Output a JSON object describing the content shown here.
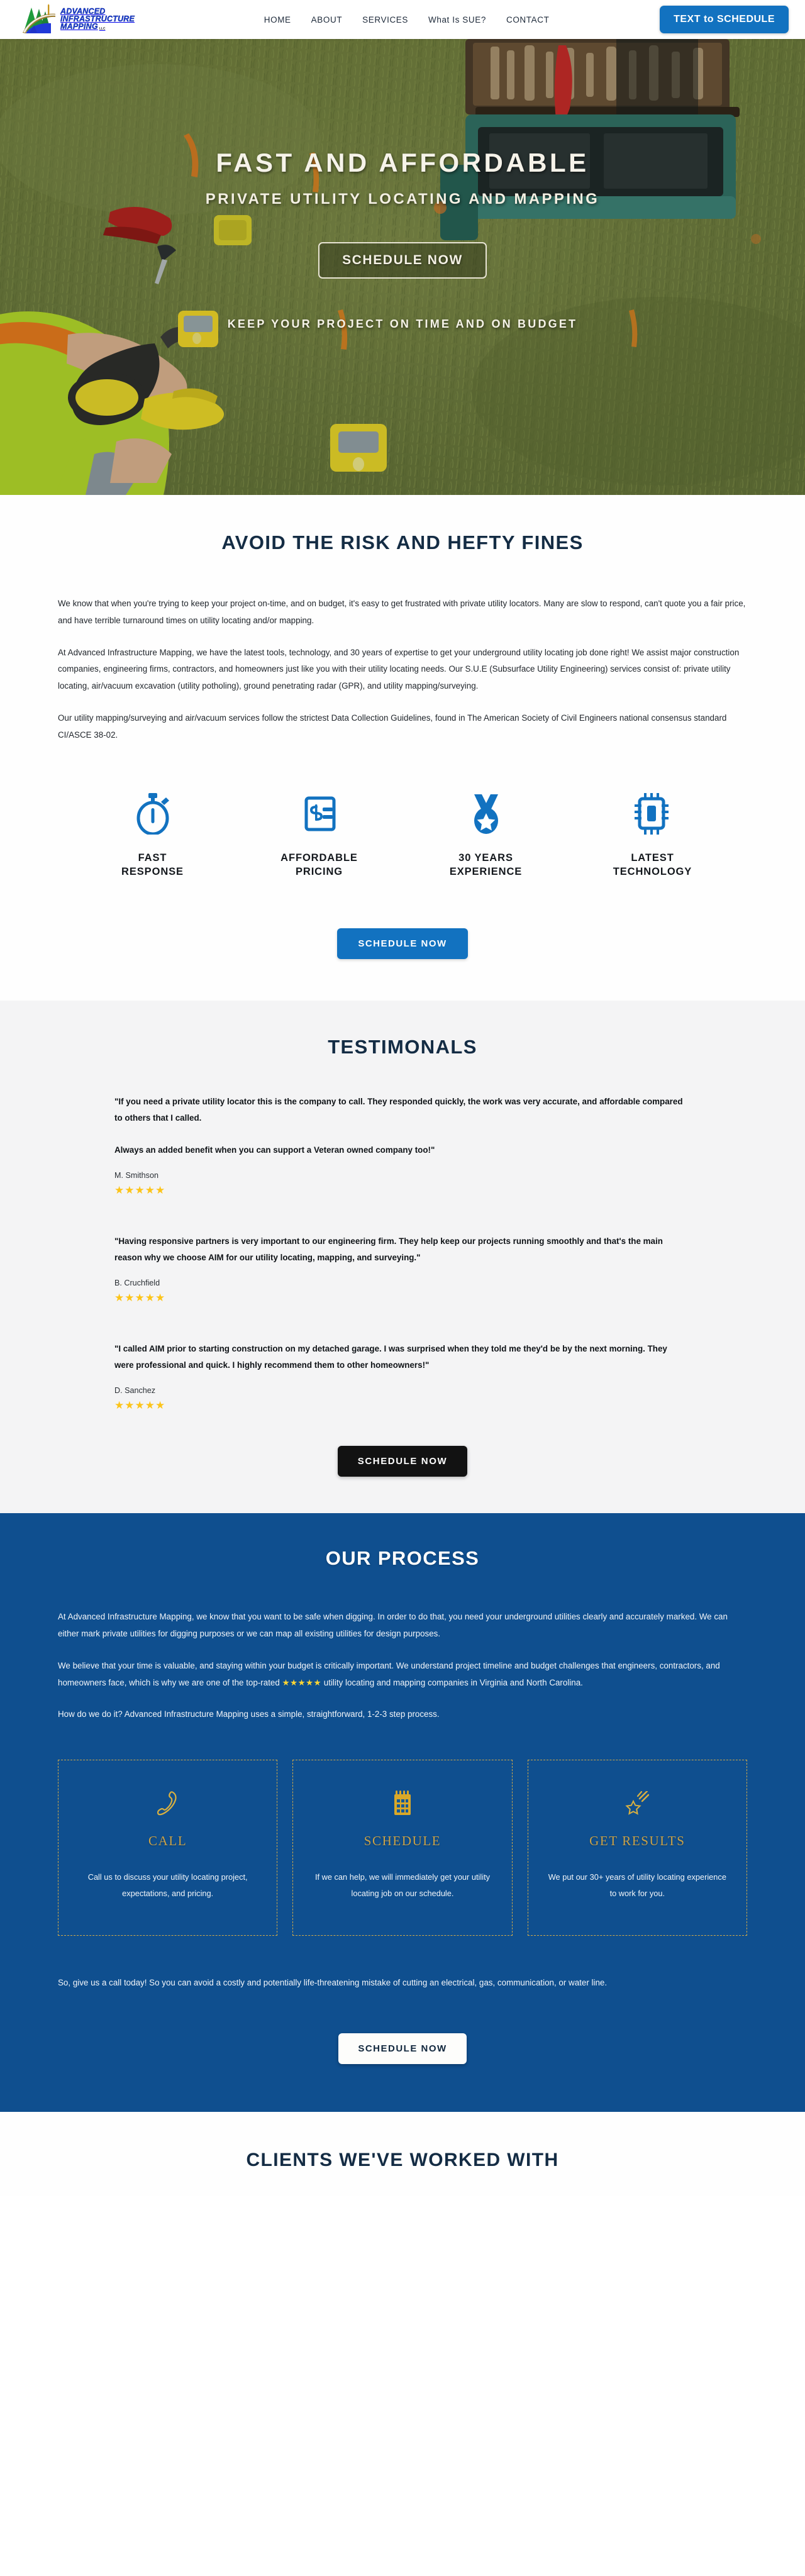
{
  "header": {
    "logo": {
      "line1": "ADVANCED",
      "line2": "INFRASTRUCTURE",
      "line3": "MAPPING",
      "suffix": "LLC"
    },
    "nav": [
      {
        "label": "HOME"
      },
      {
        "label": "ABOUT"
      },
      {
        "label": "SERVICES"
      },
      {
        "label": "What Is SUE?"
      },
      {
        "label": "CONTACT"
      }
    ],
    "cta_label": "TEXT to SCHEDULE"
  },
  "hero": {
    "headline": "FAST AND AFFORDABLE",
    "subheadline": "PRIVATE UTILITY LOCATING AND MAPPING",
    "cta_label": "SCHEDULE NOW",
    "tagline": "KEEP YOUR PROJECT ON TIME AND ON BUDGET"
  },
  "risk": {
    "title": "AVOID THE RISK AND HEFTY FINES",
    "paragraphs": [
      "We know that when you're trying to keep your project on-time, and on budget, it's easy to get frustrated with private utility locators. Many are slow to respond, can't quote you a fair price, and have terrible turnaround times on utility locating and/or mapping.",
      "At Advanced Infrastructure Mapping, we have the latest tools, technology, and 30 years of expertise to get your underground utility locating job done right! We assist major construction companies, engineering firms, contractors, and homeowners just like you with their utility locating needs.  Our S.U.E (Subsurface Utility Engineering)  services consist of: private utility locating, air/vacuum excavation (utility potholing), ground penetrating radar (GPR), and utility mapping/surveying.",
      "Our utility mapping/surveying and air/vacuum services follow the strictest Data Collection Guidelines, found in The American Society of Civil Engineers national consensus standard CI/ASCE 38-02."
    ],
    "features": [
      {
        "icon": "stopwatch-icon",
        "label": "FAST RESPONSE"
      },
      {
        "icon": "invoice-dollar-icon",
        "label": "AFFORDABLE PRICING"
      },
      {
        "icon": "medal-icon",
        "label": "30 YEARS EXPERIENCE"
      },
      {
        "icon": "microchip-icon",
        "label": "LATEST TECHNOLOGY"
      }
    ],
    "cta_label": "SCHEDULE NOW"
  },
  "testimonials": {
    "title": "TESTIMONALS",
    "items": [
      {
        "quote1": "\"If you need a private utility locator this is the company to call. They responded quickly, the work was very accurate, and affordable compared to others that I called.",
        "quote2": "Always an added benefit when you can support a Veteran owned company too!\"",
        "author": "M. Smithson",
        "stars": "★★★★★"
      },
      {
        "quote1": "\"Having responsive partners is very important to our engineering firm.  They help keep our projects running smoothly and that's the main reason why we choose AIM for our utility locating, mapping, and surveying.\"",
        "quote2": "",
        "author": "B. Cruchfield",
        "stars": "★★★★★"
      },
      {
        "quote1": "\"I called AIM prior to starting construction on my detached garage. I was surprised when they told me they'd be by the next morning. They were professional and quick. I highly recommend them to other homeowners!\"",
        "quote2": "",
        "author": "D. Sanchez",
        "stars": "★★★★★"
      }
    ],
    "cta_label": "SCHEDULE NOW"
  },
  "process": {
    "title": "OUR PROCESS",
    "paragraph1": "At Advanced Infrastructure Mapping, we know that you want to be safe when digging. In order to do that, you need your underground utilities clearly and accurately marked. We can either mark private utilities for digging purposes or we can map all existing utilities for design purposes.",
    "paragraph2_a": "We believe that your time is valuable, and staying within your budget is critically important. We understand project timeline and budget challenges that engineers, contractors, and homeowners face, which is why we are one of the top-rated ",
    "paragraph2_stars": "★★★★★",
    "paragraph2_b": " utility locating and mapping companies in Virginia and North Carolina.",
    "paragraph3": "How do we do it? Advanced Infrastructure Mapping uses a simple, straightforward, 1-2-3 step process.",
    "steps": [
      {
        "icon": "phone-icon",
        "title": "CALL",
        "text": "Call us to discuss your utility locating project, expectations, and pricing."
      },
      {
        "icon": "calendar-icon",
        "title": "SCHEDULE",
        "text": "If we can help, we will immediately get your utility locating job on our schedule."
      },
      {
        "icon": "shooting-star-icon",
        "title": "GET RESULTS",
        "text": "We put our 30+ years of utility locating experience to work for you."
      }
    ],
    "closing": "So, give us a call today! So you can avoid a costly and potentially life-threatening mistake of cutting an electrical, gas, communication, or water line.",
    "cta_label": "SCHEDULE NOW"
  },
  "clients": {
    "title": "CLIENTS WE'VE WORKED WITH"
  },
  "colors": {
    "brand_blue": "#1272c0",
    "process_blue": "#0f4f8f",
    "gold": "#c9a249",
    "star_yellow": "#fcc419",
    "dark_navy": "#142c44"
  }
}
